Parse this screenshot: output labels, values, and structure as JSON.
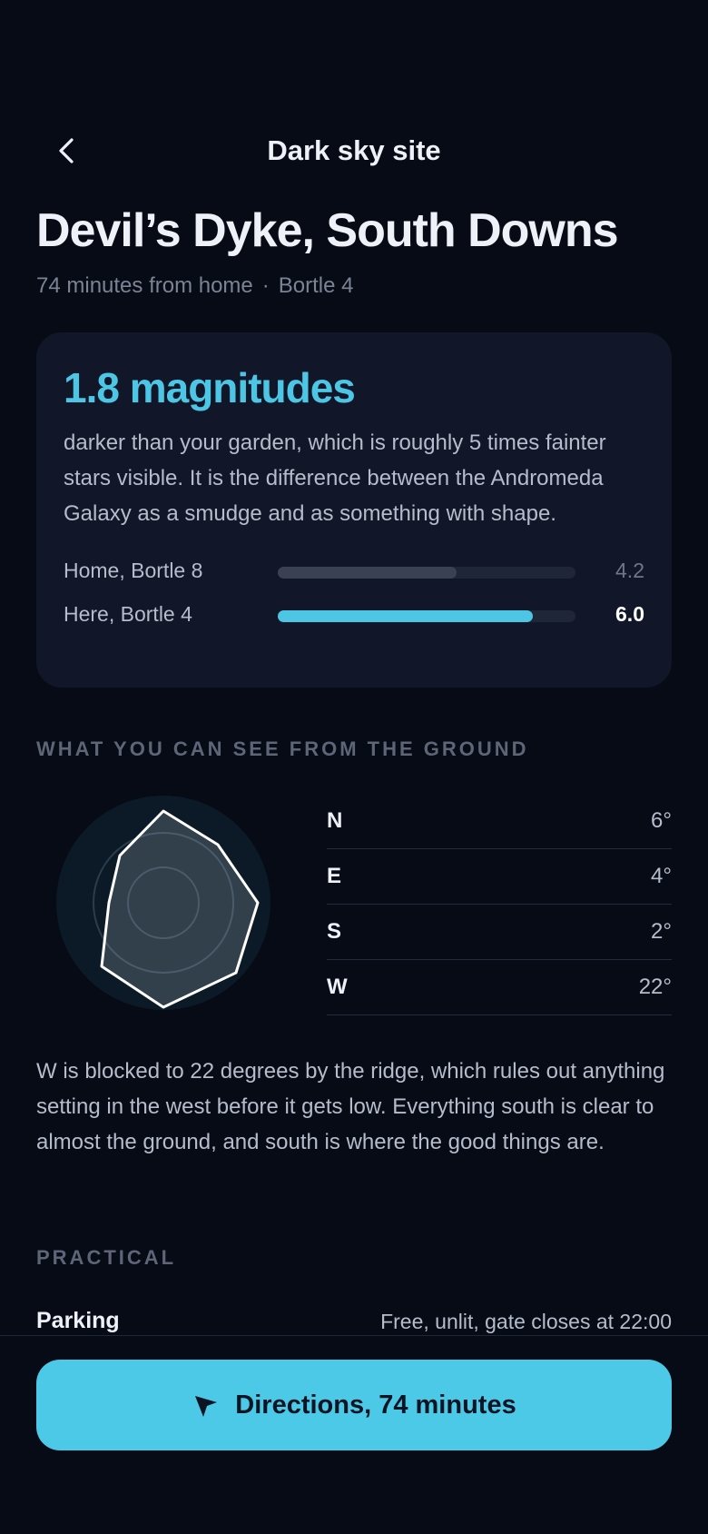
{
  "header": {
    "title": "Dark sky site"
  },
  "site": {
    "name": "Devil’s Dyke, South Downs",
    "travel": "74 minutes from home",
    "separator": "·",
    "bortle": "Bortle 4"
  },
  "comparison": {
    "headline": "1.8 magnitudes",
    "description": "darker than your garden, which is roughly 5 times fainter stars visible. It is the difference between the Andromeda Galaxy as a smudge and as something with shape.",
    "scale_max": 7,
    "rows": [
      {
        "label": "Home, Bortle 8",
        "value": "4.2",
        "fraction": 0.6,
        "color": "#3a4153"
      },
      {
        "label": "Here, Bortle 4",
        "value": "6.0",
        "fraction": 0.857,
        "color": "#4dc6e6"
      }
    ]
  },
  "horizon": {
    "section_title": "WHAT YOU CAN SEE FROM THE GROUND",
    "directions": [
      {
        "key": "N",
        "value": "6°"
      },
      {
        "key": "E",
        "value": "4°"
      },
      {
        "key": "S",
        "value": "2°"
      },
      {
        "key": "W",
        "value": "22°"
      }
    ],
    "note": "W is blocked to 22 degrees by the ridge, which rules out anything setting in the west before it gets low. Everything south is clear to almost the ground, and south is where the good things are."
  },
  "practical": {
    "section_title": "PRACTICAL",
    "items": [
      {
        "key": "Parking",
        "value": "Free, unlit, gate closes at 22:00"
      }
    ]
  },
  "cta": {
    "label": "Directions, 74 minutes",
    "icon": "navigation-arrow-icon"
  },
  "colors": {
    "accent": "#4dc6e6",
    "background": "#070b15",
    "card": "#111729"
  }
}
